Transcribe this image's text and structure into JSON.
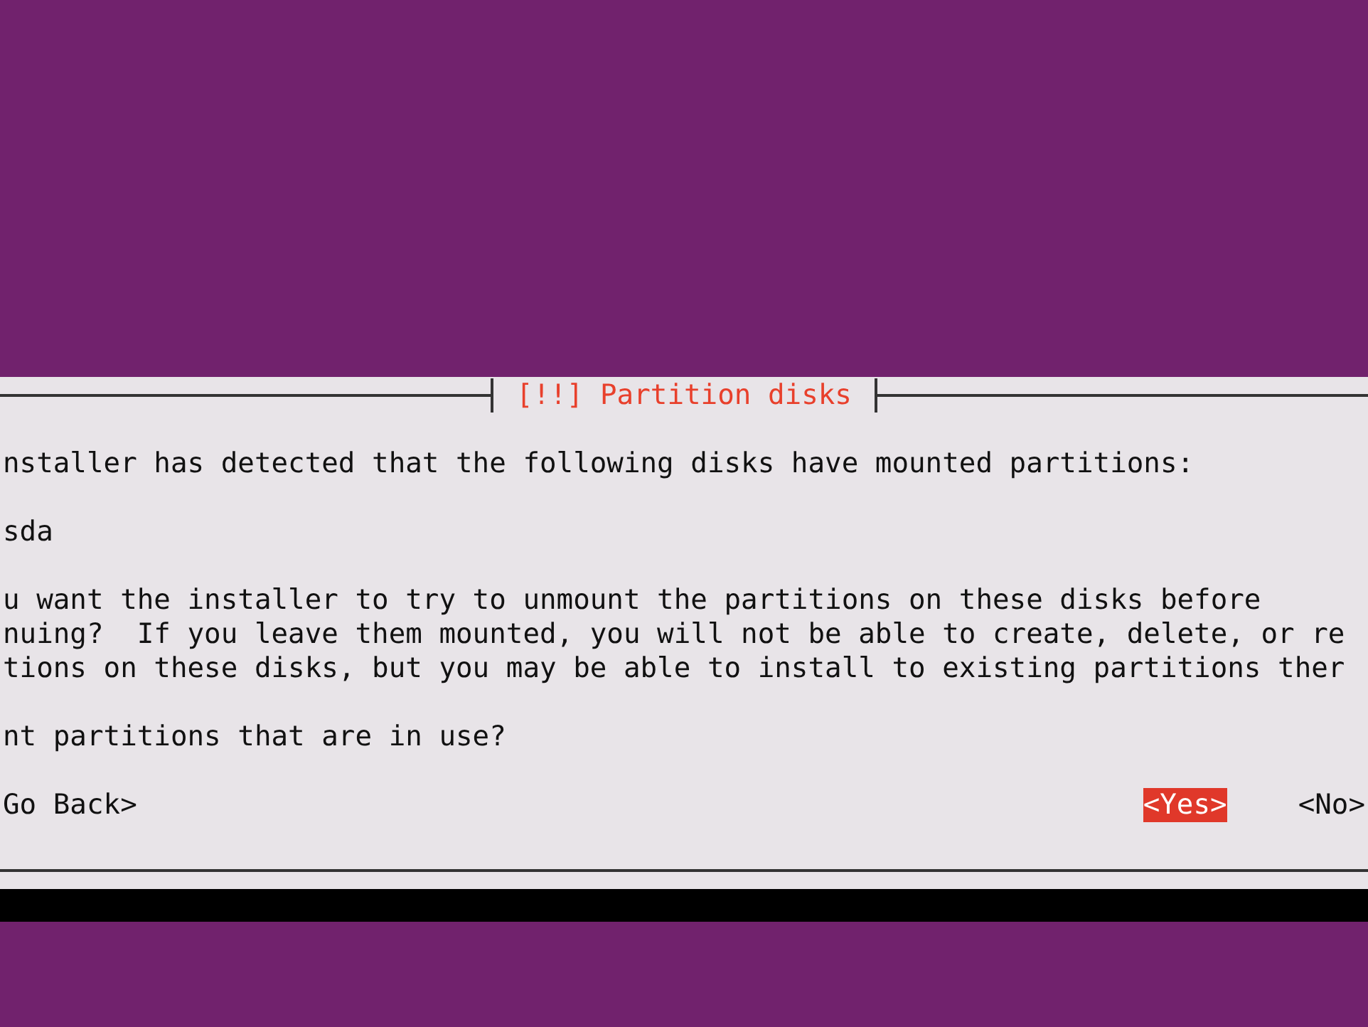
{
  "dialog": {
    "title": "[!!] Partition disks",
    "blocks": [
      {
        "lines": [
          "nstaller has detected that the following disks have mounted partitions:"
        ]
      },
      {
        "lines": [
          "sda"
        ]
      },
      {
        "lines": [
          "u want the installer to try to unmount the partitions on these disks before",
          "nuing?  If you leave them mounted, you will not be able to create, delete, or re",
          "tions on these disks, but you may be able to install to existing partitions ther"
        ]
      },
      {
        "lines": [
          "nt partitions that are in use?"
        ]
      }
    ],
    "buttons": [
      {
        "label": "Go Back>",
        "selected": false
      },
      {
        "label": "<Yes>",
        "selected": true
      },
      {
        "label": "<No>",
        "selected": false
      }
    ]
  }
}
